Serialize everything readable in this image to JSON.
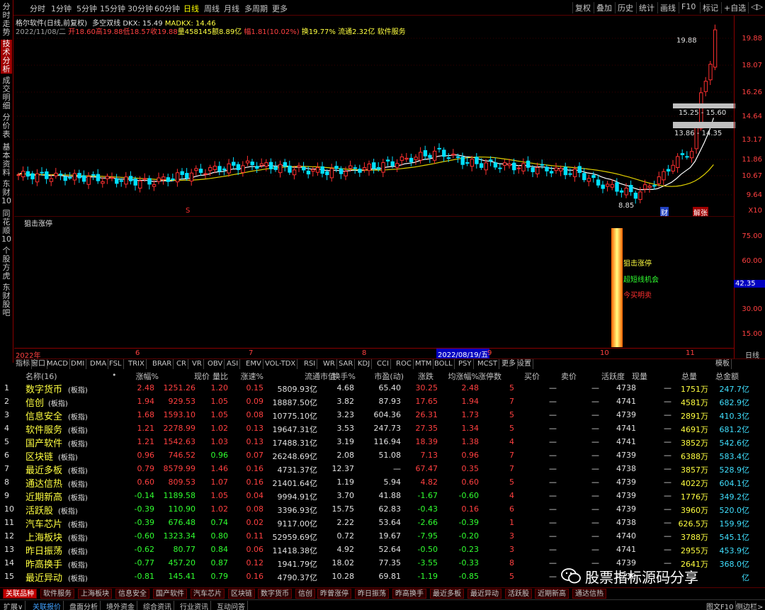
{
  "top": {
    "left_tabs": [
      "分时",
      "1分钟",
      "5分钟",
      "15分钟",
      "30分钟",
      "60分钟",
      "日线",
      "周线",
      "月线",
      "多周期",
      "更多"
    ],
    "active_tab": "日线",
    "right_buttons": [
      "复权",
      "叠加",
      "历史",
      "统计",
      "画线",
      "F10",
      "标记",
      "+自选",
      "◁▷"
    ]
  },
  "side_tabs": [
    "分时走势",
    "技术分析",
    "成交明细",
    "分价表",
    "基本资料",
    "东财10",
    "同花顺10",
    "个股方虎",
    "东财股吧"
  ],
  "stock": {
    "name_line": "格尔软件(日线,前复权)",
    "indicator_name": "多空双线",
    "dkx": "DKX: 15.49",
    "madkx": "MADKX: 14.46",
    "date": "2022/11/08/二",
    "open": "开18.60",
    "high": "高19.88",
    "low": "低18.57",
    "close": "收19.88",
    "volume": "量458145",
    "amount": "额8.89亿",
    "change": "幅1.81(10.02%)",
    "turnover": "换19.77%",
    "float": "流通2.32亿",
    "sector": "软件服务"
  },
  "price_axis": [
    "19.88",
    "18.07",
    "16.26",
    "14.64",
    "13.17",
    "11.86",
    "10.67",
    "9.64"
  ],
  "price_axis_unit": "X10",
  "annotations": {
    "high": "19.88",
    "low": "8.85",
    "box1": "15.25 - 15.60",
    "box2": "13.86 - 14.35",
    "s_mark": "S",
    "cai": "财",
    "jiezhang": "解张"
  },
  "indicator": {
    "title": "狙击涨停",
    "axis": [
      "75.00",
      "60.00",
      "42.35",
      "30.00",
      "15.00"
    ],
    "labels": [
      "狙击涨停",
      "超短线机会",
      "今买明卖"
    ]
  },
  "date_axis": [
    "2022年",
    "6",
    "7",
    "8",
    "2022/08/19/五",
    "9",
    "10",
    "11"
  ],
  "date_axis_right": "日线",
  "indicator_tabs": [
    "指标",
    "窗口",
    "MACD",
    "DMI",
    "DMA",
    "FSL",
    "TRIX",
    "BRAR",
    "CR",
    "VR",
    "OBV",
    "ASI",
    "EMV",
    "VOL-TDX",
    "RSI",
    "WR",
    "SAR",
    "KDJ",
    "CCI",
    "ROC",
    "MTM",
    "BOLL",
    "PSY",
    "MCST",
    "更多",
    "设置"
  ],
  "template_label": "模板",
  "table": {
    "headers": [
      "名称(16)",
      "•",
      "涨幅%",
      "现价",
      "量比",
      "涨速%",
      "流通市值",
      "换手%",
      "市盈(动)",
      "涨跌",
      "均涨幅%",
      "涨停数",
      "买价",
      "卖价",
      "活跃度",
      "现量",
      "总量",
      "总金额"
    ],
    "rows": [
      [
        "1",
        "数字货币",
        "(板指)",
        "2.48",
        "1251.26",
        "1.20",
        "0.15",
        "5809.93亿",
        "4.68",
        "65.40",
        "30.25",
        "2.48",
        "5",
        "—",
        "—",
        "4738",
        "—",
        "1751万",
        "247.7亿"
      ],
      [
        "2",
        "信创",
        "(板指)",
        "1.94",
        "929.53",
        "1.05",
        "0.09",
        "18887.50亿",
        "3.82",
        "87.93",
        "17.65",
        "1.94",
        "7",
        "—",
        "—",
        "4741",
        "—",
        "4581万",
        "682.9亿"
      ],
      [
        "3",
        "信息安全",
        "(板指)",
        "1.68",
        "1593.10",
        "1.05",
        "0.08",
        "10775.10亿",
        "3.23",
        "604.36",
        "26.31",
        "1.73",
        "5",
        "—",
        "—",
        "4739",
        "—",
        "2891万",
        "410.3亿"
      ],
      [
        "4",
        "软件服务",
        "(板指)",
        "1.21",
        "2278.99",
        "1.02",
        "0.13",
        "19647.31亿",
        "3.53",
        "247.73",
        "27.35",
        "1.34",
        "5",
        "—",
        "—",
        "4741",
        "—",
        "4691万",
        "681.2亿"
      ],
      [
        "5",
        "国产软件",
        "(板指)",
        "1.21",
        "1542.63",
        "1.03",
        "0.13",
        "17488.31亿",
        "3.19",
        "116.94",
        "18.39",
        "1.38",
        "4",
        "—",
        "—",
        "4741",
        "—",
        "3852万",
        "542.6亿"
      ],
      [
        "6",
        "区块链",
        "(板指)",
        "0.96",
        "746.52",
        "0.96",
        "0.07",
        "26248.69亿",
        "2.08",
        "51.08",
        "7.13",
        "0.96",
        "7",
        "—",
        "—",
        "4739",
        "—",
        "6388万",
        "583.4亿"
      ],
      [
        "7",
        "最近多板",
        "(板指)",
        "0.79",
        "8579.99",
        "1.46",
        "0.16",
        "4731.37亿",
        "12.37",
        "—",
        "67.47",
        "0.35",
        "7",
        "—",
        "—",
        "4738",
        "—",
        "3857万",
        "528.9亿"
      ],
      [
        "8",
        "通达信热",
        "(板指)",
        "0.60",
        "809.53",
        "1.07",
        "0.16",
        "21401.64亿",
        "1.19",
        "5.94",
        "4.82",
        "0.60",
        "5",
        "—",
        "—",
        "4739",
        "—",
        "4022万",
        "604.1亿"
      ],
      [
        "9",
        "近期新高",
        "(板指)",
        "-0.14",
        "1189.58",
        "1.05",
        "0.04",
        "9994.91亿",
        "3.70",
        "41.88",
        "-1.67",
        "-0.60",
        "4",
        "—",
        "—",
        "4739",
        "—",
        "1776万",
        "349.2亿"
      ],
      [
        "10",
        "活跃股",
        "(板指)",
        "-0.39",
        "110.90",
        "1.02",
        "0.08",
        "3396.93亿",
        "15.75",
        "62.83",
        "-0.43",
        "0.16",
        "6",
        "—",
        "—",
        "4739",
        "—",
        "3960万",
        "520.0亿"
      ],
      [
        "11",
        "汽车芯片",
        "(板指)",
        "-0.39",
        "676.48",
        "0.74",
        "0.02",
        "9117.00亿",
        "2.22",
        "53.64",
        "-2.66",
        "-0.39",
        "1",
        "—",
        "—",
        "4738",
        "—",
        "626.5万",
        "159.9亿"
      ],
      [
        "12",
        "上海板块",
        "(板指)",
        "-0.60",
        "1323.34",
        "0.80",
        "0.11",
        "52959.69亿",
        "0.72",
        "19.67",
        "-7.95",
        "-0.20",
        "3",
        "—",
        "—",
        "4740",
        "—",
        "3788万",
        "545.1亿"
      ],
      [
        "13",
        "昨日振荡",
        "(板指)",
        "-0.62",
        "80.77",
        "0.84",
        "0.06",
        "11418.38亿",
        "4.92",
        "52.64",
        "-0.50",
        "-0.23",
        "3",
        "—",
        "—",
        "4741",
        "—",
        "2955万",
        "453.9亿"
      ],
      [
        "14",
        "昨高换手",
        "(板指)",
        "-0.77",
        "457.20",
        "0.87",
        "0.12",
        "1941.79亿",
        "18.02",
        "77.35",
        "-3.55",
        "-0.33",
        "8",
        "—",
        "—",
        "4739",
        "—",
        "2641万",
        "368.0亿"
      ],
      [
        "15",
        "最近异动",
        "(板指)",
        "-0.81",
        "145.41",
        "0.79",
        "0.16",
        "4790.37亿",
        "10.28",
        "69.81",
        "-1.19",
        "-0.85",
        "5",
        "—",
        "—",
        "4739",
        "—",
        "",
        "亿"
      ]
    ]
  },
  "sector_tabs": [
    "关联品种",
    "软件服务",
    "上海板块",
    "信息安全",
    "国产软件",
    "汽车芯片",
    "区块链",
    "数字货币",
    "信创",
    "昨曾涨停",
    "昨日振荡",
    "昨高换手",
    "最近多板",
    "最近异动",
    "活跃股",
    "近期新高",
    "通达信热"
  ],
  "bottom_tabs": [
    "扩展∨",
    "关联报价",
    "盘面分析",
    "境外资金",
    "综合资讯",
    "行业资讯",
    "互动问答"
  ],
  "bottom_right": [
    "图文F10",
    "侧边栏>"
  ],
  "watermark": "股票指标源码分享"
}
